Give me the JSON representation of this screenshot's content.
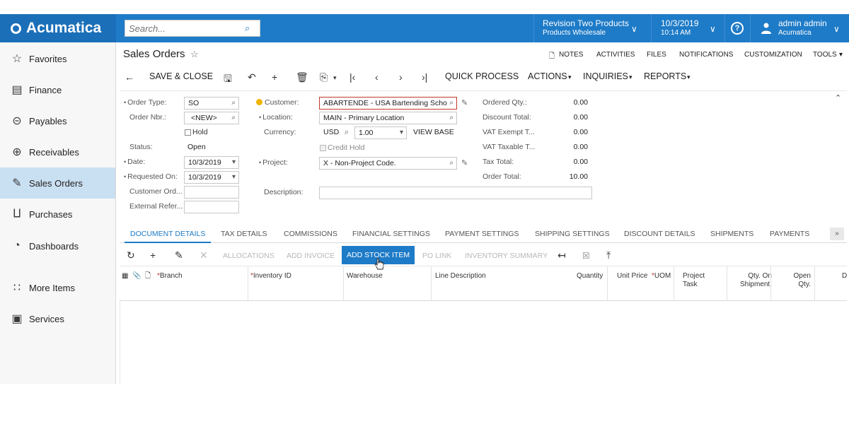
{
  "topbar": {
    "brand": "Acumatica",
    "search_placeholder": "Search...",
    "branch": {
      "title": "Revision Two Products",
      "subtitle": "Products Wholesale"
    },
    "datetime": {
      "date": "10/3/2019",
      "time": "10:14 AM"
    },
    "help": "?",
    "user": {
      "name": "admin admin",
      "company": "Acumatica"
    }
  },
  "sidebar": {
    "items": [
      {
        "label": "Favorites",
        "icon": "star-icon"
      },
      {
        "label": "Finance",
        "icon": "calculator-icon"
      },
      {
        "label": "Payables",
        "icon": "minus-circle-icon"
      },
      {
        "label": "Receivables",
        "icon": "plus-circle-icon"
      },
      {
        "label": "Sales Orders",
        "icon": "edit-icon",
        "active": true
      },
      {
        "label": "Purchases",
        "icon": "cart-icon"
      },
      {
        "label": "Dashboards",
        "icon": "gauge-icon"
      },
      {
        "label": "More Items",
        "icon": "grid-dots-icon"
      },
      {
        "label": "Services",
        "icon": "briefcase-icon"
      }
    ]
  },
  "page": {
    "title": "Sales Orders",
    "toplinks": [
      "NOTES",
      "ACTIVITIES",
      "FILES",
      "NOTIFICATIONS",
      "CUSTOMIZATION",
      "TOOLS"
    ],
    "toolbar": {
      "save_close": "SAVE & CLOSE",
      "quick_process": "QUICK PROCESS",
      "actions": "ACTIONS",
      "inquiries": "INQUIRIES",
      "reports": "REPORTS"
    }
  },
  "form": {
    "order_type": {
      "label": "Order Type:",
      "value": "SO"
    },
    "order_nbr": {
      "label": "Order Nbr.:",
      "value": "<NEW>"
    },
    "hold": {
      "label": "Hold"
    },
    "status": {
      "label": "Status:",
      "value": "Open"
    },
    "date": {
      "label": "Date:",
      "value": "10/3/2019"
    },
    "requested_on": {
      "label": "Requested On:",
      "value": "10/3/2019"
    },
    "customer_ord": {
      "label": "Customer Ord...",
      "value": ""
    },
    "external_ref": {
      "label": "External Refer...",
      "value": ""
    },
    "customer": {
      "label": "Customer:",
      "value": "ABARTENDE - USA Bartending Scho"
    },
    "location": {
      "label": "Location:",
      "value": "MAIN - Primary Location"
    },
    "currency": {
      "label": "Currency:",
      "code": "USD",
      "rate": "1.00",
      "view_base": "VIEW BASE"
    },
    "credit_hold": {
      "label": "Credit Hold"
    },
    "project": {
      "label": "Project:",
      "value": "X - Non-Project Code."
    },
    "description": {
      "label": "Description:",
      "value": ""
    },
    "totals": [
      {
        "label": "Ordered Qty.:",
        "value": "0.00"
      },
      {
        "label": "Discount Total:",
        "value": "0.00"
      },
      {
        "label": "VAT Exempt T...",
        "value": "0.00"
      },
      {
        "label": "VAT Taxable T...",
        "value": "0.00"
      },
      {
        "label": "Tax Total:",
        "value": "0.00"
      },
      {
        "label": "Order Total:",
        "value": "10.00"
      }
    ]
  },
  "tabs": [
    "DOCUMENT DETAILS",
    "TAX DETAILS",
    "COMMISSIONS",
    "FINANCIAL SETTINGS",
    "PAYMENT SETTINGS",
    "SHIPPING SETTINGS",
    "DISCOUNT DETAILS",
    "SHIPMENTS",
    "PAYMENTS"
  ],
  "grid_toolbar": {
    "allocations": "ALLOCATIONS",
    "add_invoice": "ADD INVOICE",
    "add_stock_item": "ADD STOCK ITEM",
    "po_link": "PO LINK",
    "inventory_summary": "INVENTORY SUMMARY"
  },
  "grid_columns": {
    "branch": "Branch",
    "inventory_id": "Inventory ID",
    "warehouse": "Warehouse",
    "line_description": "Line Description",
    "quantity": "Quantity",
    "unit_price": "Unit Price",
    "uom": "UOM",
    "project_task_1": "Project",
    "project_task_2": "Task",
    "qty_on_ship_1": "Qty. On",
    "qty_on_ship_2": "Shipment:",
    "open_qty_1": "Open",
    "open_qty_2": "Qty.",
    "cut": "D"
  },
  "colors": {
    "accent": "#1e7bc7",
    "active_nav": "#c9dff2",
    "required": "#c0392b"
  }
}
